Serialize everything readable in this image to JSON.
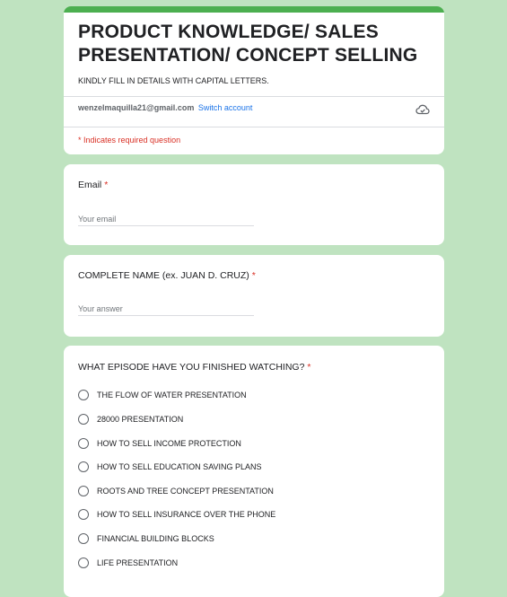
{
  "form": {
    "title": "PRODUCT KNOWLEDGE/ SALES PRESENTATION/ CONCEPT SELLING",
    "description": "KINDLY FILL IN DETAILS WITH CAPITAL LETTERS.",
    "account_email": "wenzelmaquilla21@gmail.com",
    "switch_account": "Switch account",
    "required_note": "* Indicates required question",
    "accent_color": "#4caf50",
    "background_color": "#bfe3c0"
  },
  "questions": {
    "email": {
      "label": "Email",
      "required_mark": "*",
      "placeholder": "Your email"
    },
    "name": {
      "label": "COMPLETE NAME (ex. JUAN D. CRUZ)",
      "required_mark": "*",
      "placeholder": "Your answer"
    },
    "episode": {
      "label": "WHAT EPISODE HAVE YOU FINISHED WATCHING?",
      "required_mark": "*",
      "options": [
        "THE FLOW OF WATER PRESENTATION",
        "28000 PRESENTATION",
        "HOW TO SELL INCOME PROTECTION",
        "HOW TO SELL EDUCATION SAVING PLANS",
        "ROOTS AND TREE CONCEPT PRESENTATION",
        "HOW TO SELL INSURANCE OVER THE PHONE",
        "FINANCIAL BUILDING BLOCKS",
        "LIFE PRESENTATION"
      ]
    }
  },
  "icons": {
    "save_status": "cloud-icon"
  }
}
